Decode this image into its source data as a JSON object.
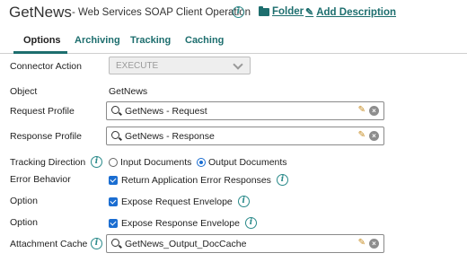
{
  "header": {
    "title": "GetNews",
    "subtitle": "- Web Services SOAP Client Operation",
    "folder_label": "Folder",
    "add_description_label": "Add Description"
  },
  "tabs": [
    {
      "label": "Options",
      "active": true
    },
    {
      "label": "Archiving",
      "active": false
    },
    {
      "label": "Tracking",
      "active": false
    },
    {
      "label": "Caching",
      "active": false
    }
  ],
  "form": {
    "connector_action": {
      "label": "Connector Action",
      "value": "EXECUTE"
    },
    "object": {
      "label": "Object",
      "value": "GetNews"
    },
    "request_profile": {
      "label": "Request Profile",
      "value": "GetNews - Request"
    },
    "response_profile": {
      "label": "Response Profile",
      "value": "GetNews - Response"
    },
    "tracking_direction": {
      "label": "Tracking Direction",
      "options": [
        {
          "label": "Input Documents",
          "selected": false
        },
        {
          "label": "Output Documents",
          "selected": true
        }
      ]
    },
    "error_behavior": {
      "label": "Error Behavior",
      "checkbox_label": "Return Application Error Responses",
      "checked": true
    },
    "option_request": {
      "label": "Option",
      "checkbox_label": "Expose Request Envelope",
      "checked": true
    },
    "option_response": {
      "label": "Option",
      "checkbox_label": "Expose Response Envelope",
      "checked": true
    },
    "attachment_cache": {
      "label": "Attachment Cache",
      "value": "GetNews_Output_DocCache"
    }
  },
  "colors": {
    "accent": "#1d6e6e",
    "checkbox": "#1a6dd1",
    "edit_icon": "#c58a1f"
  },
  "icons": {
    "info": "info-icon",
    "folder": "folder-icon",
    "pencil": "pencil-icon",
    "search": "search-icon",
    "clear": "clear-icon",
    "dropdown": "chevron-down-icon"
  }
}
